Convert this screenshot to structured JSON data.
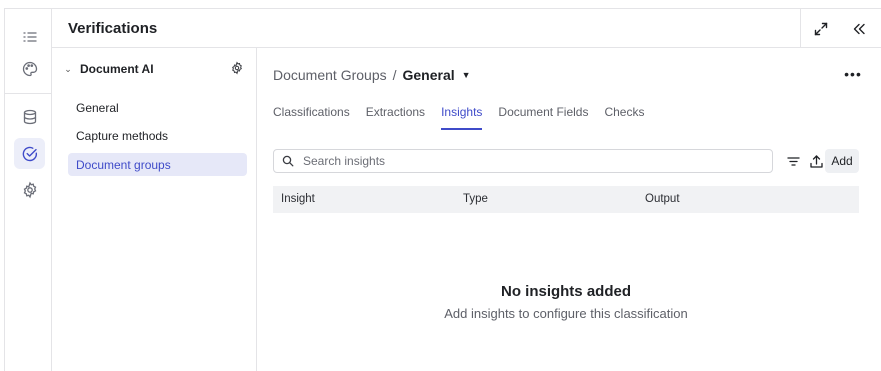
{
  "app": {
    "title": "Verifications"
  },
  "rail": {
    "items": [
      {
        "icon": "list-icon",
        "active": false
      },
      {
        "icon": "palette-icon",
        "active": false
      },
      {
        "icon": "database-icon",
        "active": false
      },
      {
        "icon": "check-circle-icon",
        "active": true
      },
      {
        "icon": "gear-icon",
        "active": false
      }
    ]
  },
  "header": {
    "expand_icon": "expand-icon",
    "collapse_icon": "double-chevron-left-icon"
  },
  "nav": {
    "group_label": "Document AI",
    "items": [
      {
        "label": "General",
        "active": false
      },
      {
        "label": "Capture methods",
        "active": false
      },
      {
        "label": "Document groups",
        "active": true
      }
    ]
  },
  "breadcrumb": {
    "parent": "Document Groups",
    "separator": "/",
    "current": "General"
  },
  "more_label": "•••",
  "tabs": [
    {
      "label": "Classifications",
      "active": false
    },
    {
      "label": "Extractions",
      "active": false
    },
    {
      "label": "Insights",
      "active": true
    },
    {
      "label": "Document Fields",
      "active": false
    },
    {
      "label": "Checks",
      "active": false
    }
  ],
  "search": {
    "placeholder": "Search insights",
    "value": ""
  },
  "toolbar": {
    "add_label": "Add"
  },
  "table": {
    "columns": [
      "Insight",
      "Type",
      "Output"
    ]
  },
  "empty_state": {
    "title": "No insights added",
    "subtitle": "Add insights to configure this classification"
  },
  "colors": {
    "accent": "#3f4bc9",
    "active_bg": "#e6e8f8"
  }
}
